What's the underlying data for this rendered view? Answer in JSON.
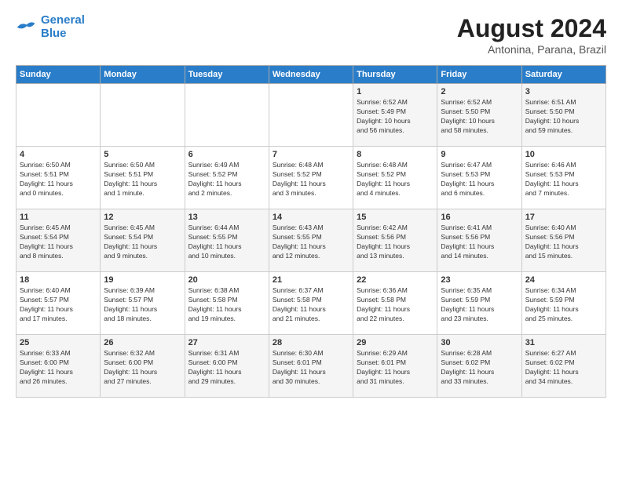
{
  "header": {
    "logo_line1": "General",
    "logo_line2": "Blue",
    "month": "August 2024",
    "location": "Antonina, Parana, Brazil"
  },
  "weekdays": [
    "Sunday",
    "Monday",
    "Tuesday",
    "Wednesday",
    "Thursday",
    "Friday",
    "Saturday"
  ],
  "weeks": [
    [
      {
        "day": "",
        "info": ""
      },
      {
        "day": "",
        "info": ""
      },
      {
        "day": "",
        "info": ""
      },
      {
        "day": "",
        "info": ""
      },
      {
        "day": "1",
        "info": "Sunrise: 6:52 AM\nSunset: 5:49 PM\nDaylight: 10 hours\nand 56 minutes."
      },
      {
        "day": "2",
        "info": "Sunrise: 6:52 AM\nSunset: 5:50 PM\nDaylight: 10 hours\nand 58 minutes."
      },
      {
        "day": "3",
        "info": "Sunrise: 6:51 AM\nSunset: 5:50 PM\nDaylight: 10 hours\nand 59 minutes."
      }
    ],
    [
      {
        "day": "4",
        "info": "Sunrise: 6:50 AM\nSunset: 5:51 PM\nDaylight: 11 hours\nand 0 minutes."
      },
      {
        "day": "5",
        "info": "Sunrise: 6:50 AM\nSunset: 5:51 PM\nDaylight: 11 hours\nand 1 minute."
      },
      {
        "day": "6",
        "info": "Sunrise: 6:49 AM\nSunset: 5:52 PM\nDaylight: 11 hours\nand 2 minutes."
      },
      {
        "day": "7",
        "info": "Sunrise: 6:48 AM\nSunset: 5:52 PM\nDaylight: 11 hours\nand 3 minutes."
      },
      {
        "day": "8",
        "info": "Sunrise: 6:48 AM\nSunset: 5:52 PM\nDaylight: 11 hours\nand 4 minutes."
      },
      {
        "day": "9",
        "info": "Sunrise: 6:47 AM\nSunset: 5:53 PM\nDaylight: 11 hours\nand 6 minutes."
      },
      {
        "day": "10",
        "info": "Sunrise: 6:46 AM\nSunset: 5:53 PM\nDaylight: 11 hours\nand 7 minutes."
      }
    ],
    [
      {
        "day": "11",
        "info": "Sunrise: 6:45 AM\nSunset: 5:54 PM\nDaylight: 11 hours\nand 8 minutes."
      },
      {
        "day": "12",
        "info": "Sunrise: 6:45 AM\nSunset: 5:54 PM\nDaylight: 11 hours\nand 9 minutes."
      },
      {
        "day": "13",
        "info": "Sunrise: 6:44 AM\nSunset: 5:55 PM\nDaylight: 11 hours\nand 10 minutes."
      },
      {
        "day": "14",
        "info": "Sunrise: 6:43 AM\nSunset: 5:55 PM\nDaylight: 11 hours\nand 12 minutes."
      },
      {
        "day": "15",
        "info": "Sunrise: 6:42 AM\nSunset: 5:56 PM\nDaylight: 11 hours\nand 13 minutes."
      },
      {
        "day": "16",
        "info": "Sunrise: 6:41 AM\nSunset: 5:56 PM\nDaylight: 11 hours\nand 14 minutes."
      },
      {
        "day": "17",
        "info": "Sunrise: 6:40 AM\nSunset: 5:56 PM\nDaylight: 11 hours\nand 15 minutes."
      }
    ],
    [
      {
        "day": "18",
        "info": "Sunrise: 6:40 AM\nSunset: 5:57 PM\nDaylight: 11 hours\nand 17 minutes."
      },
      {
        "day": "19",
        "info": "Sunrise: 6:39 AM\nSunset: 5:57 PM\nDaylight: 11 hours\nand 18 minutes."
      },
      {
        "day": "20",
        "info": "Sunrise: 6:38 AM\nSunset: 5:58 PM\nDaylight: 11 hours\nand 19 minutes."
      },
      {
        "day": "21",
        "info": "Sunrise: 6:37 AM\nSunset: 5:58 PM\nDaylight: 11 hours\nand 21 minutes."
      },
      {
        "day": "22",
        "info": "Sunrise: 6:36 AM\nSunset: 5:58 PM\nDaylight: 11 hours\nand 22 minutes."
      },
      {
        "day": "23",
        "info": "Sunrise: 6:35 AM\nSunset: 5:59 PM\nDaylight: 11 hours\nand 23 minutes."
      },
      {
        "day": "24",
        "info": "Sunrise: 6:34 AM\nSunset: 5:59 PM\nDaylight: 11 hours\nand 25 minutes."
      }
    ],
    [
      {
        "day": "25",
        "info": "Sunrise: 6:33 AM\nSunset: 6:00 PM\nDaylight: 11 hours\nand 26 minutes."
      },
      {
        "day": "26",
        "info": "Sunrise: 6:32 AM\nSunset: 6:00 PM\nDaylight: 11 hours\nand 27 minutes."
      },
      {
        "day": "27",
        "info": "Sunrise: 6:31 AM\nSunset: 6:00 PM\nDaylight: 11 hours\nand 29 minutes."
      },
      {
        "day": "28",
        "info": "Sunrise: 6:30 AM\nSunset: 6:01 PM\nDaylight: 11 hours\nand 30 minutes."
      },
      {
        "day": "29",
        "info": "Sunrise: 6:29 AM\nSunset: 6:01 PM\nDaylight: 11 hours\nand 31 minutes."
      },
      {
        "day": "30",
        "info": "Sunrise: 6:28 AM\nSunset: 6:02 PM\nDaylight: 11 hours\nand 33 minutes."
      },
      {
        "day": "31",
        "info": "Sunrise: 6:27 AM\nSunset: 6:02 PM\nDaylight: 11 hours\nand 34 minutes."
      }
    ]
  ]
}
